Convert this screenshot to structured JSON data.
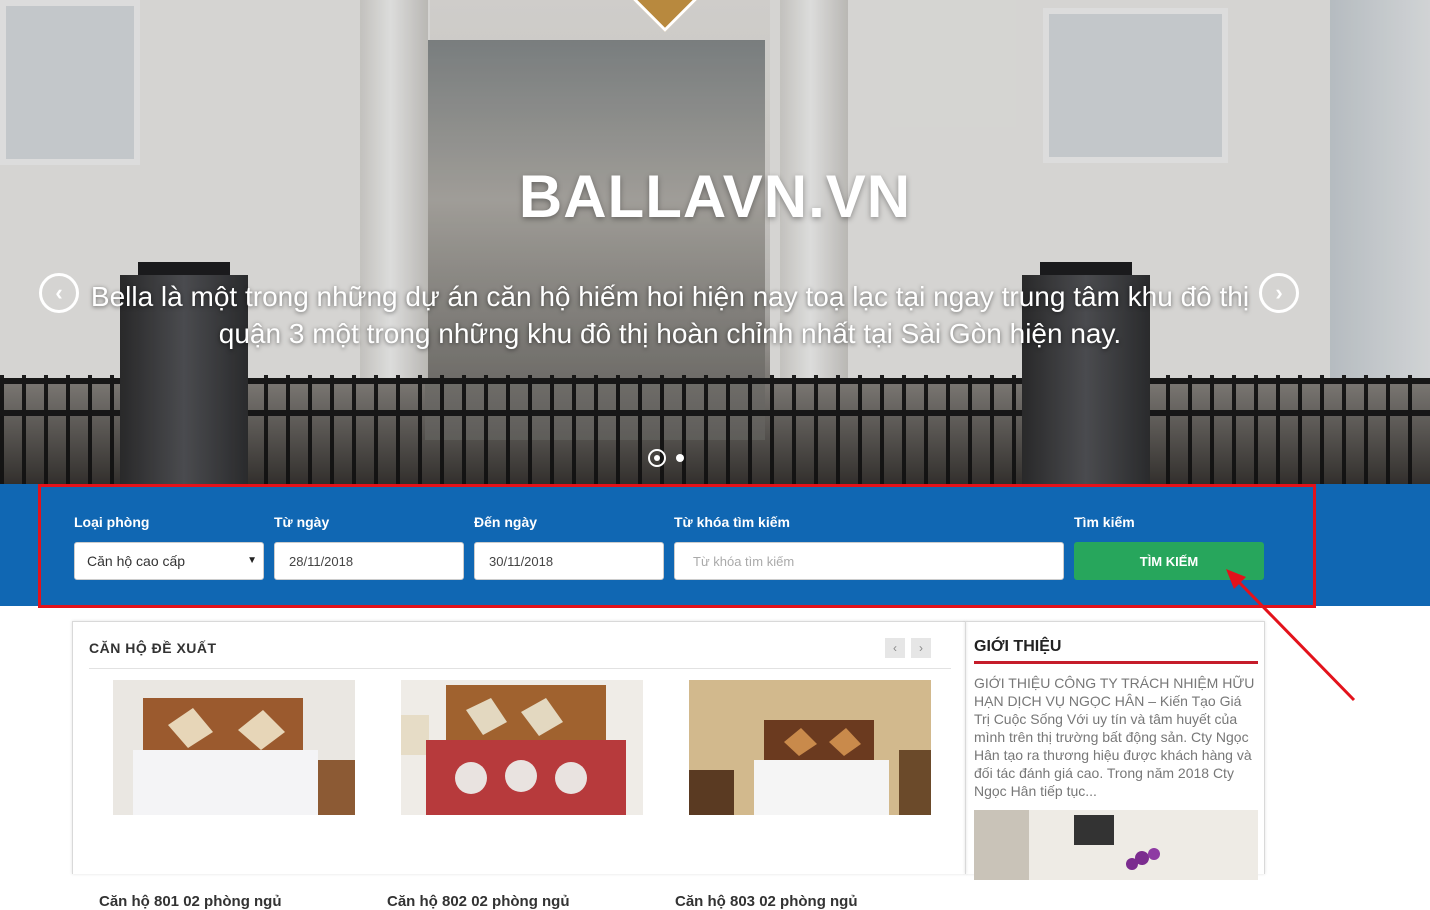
{
  "hero": {
    "title": "BALLAVN.VN",
    "description": "Bella là một trong những dự án căn hộ hiếm hoi hiện nay toạ lạc tại ngay trung tâm khu đô thị quận 3 một trong những khu đô thị hoàn chỉnh nhất tại Sài Gòn hiện nay.",
    "prev_icon": "chevron-left-icon",
    "next_icon": "chevron-right-icon",
    "prev_glyph": "‹",
    "next_glyph": "›",
    "slides_count": 2,
    "active_slide": 1
  },
  "search": {
    "room_type_label": "Loại phòng",
    "room_type_value": "Căn hộ cao cấp",
    "from_label": "Từ ngày",
    "from_value": "28/11/2018",
    "to_label": "Đến ngày",
    "to_value": "30/11/2018",
    "keyword_label": "Từ khóa tìm kiếm",
    "keyword_placeholder": "Từ khóa tìm kiếm",
    "submit_label": "Tìm kiếm",
    "submit_button": "TÌM KIẾM",
    "caret": "▼",
    "button_color": "#27a65c",
    "bar_color": "#1067b3"
  },
  "featured": {
    "title": "CĂN HỘ ĐỀ XUẤT",
    "prev": "‹",
    "next": "›",
    "items": [
      {
        "title": "Căn hộ 801 02 phòng ngủ"
      },
      {
        "title": "Căn hộ 802 02 phòng ngủ"
      },
      {
        "title": "Căn hộ 803 02 phòng ngủ"
      }
    ]
  },
  "about": {
    "title": "GIỚI THIỆU",
    "text": "GIỚI THIỆU CÔNG TY TRÁCH NHIỆM HỮU HẠN DỊCH VỤ NGỌC HÂN – Kiến Tạo Giá Trị Cuộc Sống Với uy tín và tâm huyết của mình trên thị trường bất động sản. Cty Ngọc Hân tạo ra thương hiệu được khách hàng và đối tác đánh giá cao. Trong năm 2018 Cty Ngọc Hân tiếp tục...",
    "accent": "#c51c2a"
  },
  "annotation": {
    "highlight_color": "#e3121b"
  }
}
